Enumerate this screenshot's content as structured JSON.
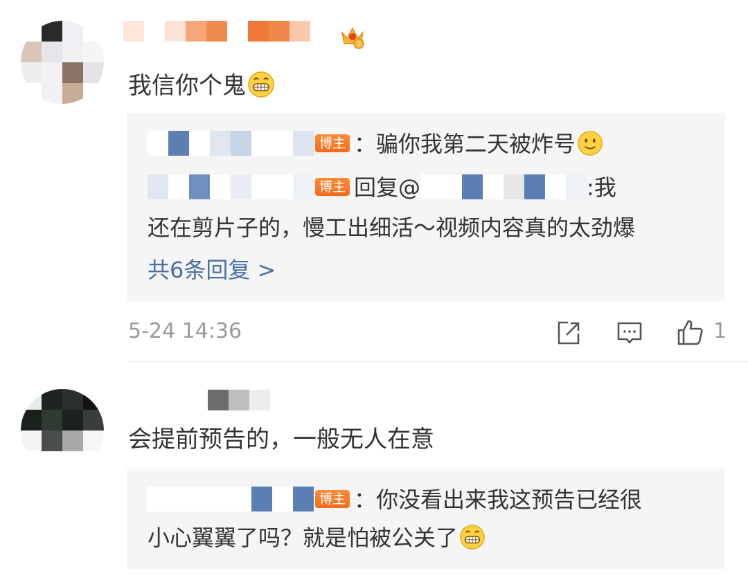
{
  "comments": [
    {
      "text": "我信你个鬼",
      "reply_box": {
        "replies": [
          {
            "badge": "博主",
            "text": "：骗你我第二天被炸号"
          },
          {
            "badge": "博主",
            "text_a": "回复@",
            "text_b": ":我",
            "text_c": "还在剪片子的，慢工出细活～视频内容真的太劲爆"
          }
        ],
        "more_label": "共6条回复 >"
      },
      "time": "5-24 14:36",
      "like_count": "1"
    },
    {
      "text": "会提前预告的，一般无人在意",
      "reply_box": {
        "replies": [
          {
            "badge": "博主",
            "text_a": "：你没看出来我这预告已经很",
            "text_b": "小心翼翼了吗？就是怕被公关了"
          }
        ]
      }
    }
  ],
  "icons": {
    "crown": "crown-level-icon",
    "grin": "grin-emoji-icon",
    "smile": "smile-emoji-icon",
    "share": "share-icon",
    "comment": "comment-icon",
    "like": "like-icon"
  },
  "colors": {
    "badge": "#f46a1b",
    "link": "#4a6fa5",
    "reply_bg": "#f5f5f5",
    "meta": "#9a9a9a"
  }
}
